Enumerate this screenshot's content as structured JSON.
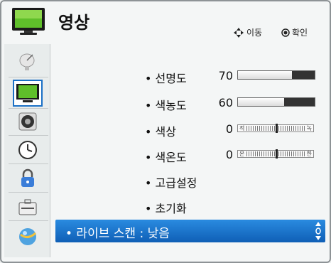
{
  "header": {
    "title": "영상",
    "hint_move": "이동",
    "hint_confirm": "확인"
  },
  "sidebar": {
    "items": [
      {
        "icon": "satellite-dish-icon"
      },
      {
        "icon": "tv-picture-icon",
        "selected": true
      },
      {
        "icon": "speaker-icon"
      },
      {
        "icon": "clock-icon"
      },
      {
        "icon": "lock-icon"
      },
      {
        "icon": "toolbox-icon"
      },
      {
        "icon": "globe-icon"
      }
    ]
  },
  "menu": {
    "items": [
      {
        "label": "• 선명도",
        "value": "70",
        "level": 0.7
      },
      {
        "label": "• 색농도",
        "value": "60",
        "level": 0.6
      },
      {
        "label": "• 색상",
        "value": "0",
        "left": "적",
        "right": "녹"
      },
      {
        "label": "• 색온도",
        "value": "0",
        "left": "온",
        "right": "한"
      },
      {
        "label": "• 고급설정"
      },
      {
        "label": "• 초기화"
      }
    ],
    "selected": {
      "label": "• 라이브 스캔 : 낮음"
    }
  },
  "colors": {
    "accent": "#1b70c6",
    "highlight_top": "#2a8be0",
    "highlight_bottom": "#0f5fb6"
  }
}
